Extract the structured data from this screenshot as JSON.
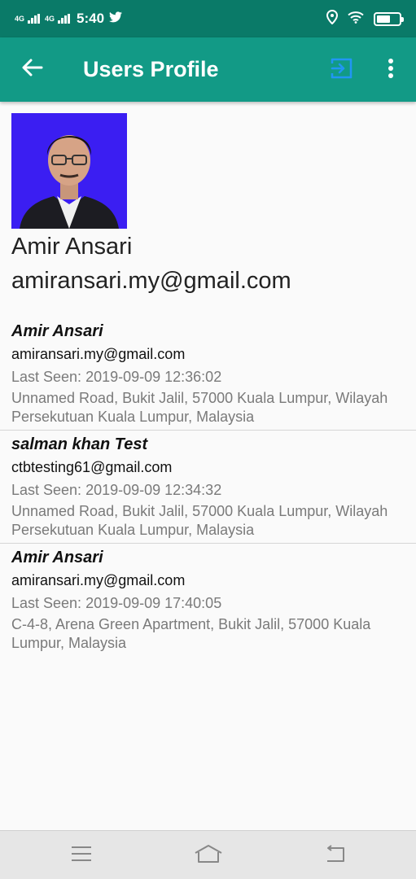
{
  "status_bar": {
    "network_1": "4G",
    "network_2": "4G",
    "time": "5:40",
    "icons": [
      "twitter-icon",
      "location-icon",
      "wifi-icon",
      "battery-icon"
    ],
    "battery_level": 0.6
  },
  "app_bar": {
    "title": "Users Profile",
    "back_icon": "arrow-left-icon",
    "logout_icon": "logout-icon",
    "menu_icon": "more-vert-icon",
    "background": "#129a86",
    "status_background": "#0a7a68",
    "logout_icon_color": "#2196f3"
  },
  "profile": {
    "name": "Amir Ansari",
    "email": "amiransari.my@gmail.com",
    "photo_background": "#3b1ef2"
  },
  "sessions": [
    {
      "name": "Amir Ansari",
      "email": "amiransari.my@gmail.com",
      "last_seen": "Last Seen: 2019-09-09 12:36:02",
      "address": "Unnamed Road, Bukit Jalil, 57000 Kuala Lumpur, Wilayah Persekutuan Kuala Lumpur, Malaysia"
    },
    {
      "name": "salman khan Test",
      "email": "ctbtesting61@gmail.com",
      "last_seen": "Last Seen: 2019-09-09 12:34:32",
      "address": "Unnamed Road, Bukit Jalil, 57000 Kuala Lumpur, Wilayah Persekutuan Kuala Lumpur, Malaysia"
    },
    {
      "name": "Amir Ansari",
      "email": "amiransari.my@gmail.com",
      "last_seen": "Last Seen: 2019-09-09 17:40:05",
      "address": "C-4-8, Arena Green Apartment, Bukit Jalil, 57000 Kuala Lumpur, Malaysia"
    }
  ],
  "nav_bar": {
    "icons": [
      "menu-icon",
      "home-icon",
      "back-icon"
    ]
  }
}
